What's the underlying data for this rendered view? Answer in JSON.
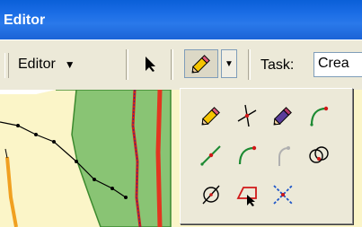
{
  "window": {
    "title": "Editor"
  },
  "toolbar": {
    "editor_menu_label": "Editor",
    "task_label": "Task:",
    "task_value": "Crea"
  },
  "palette": {
    "tools": [
      {
        "icon": "sketch-pencil-icon"
      },
      {
        "icon": "intersection-icon"
      },
      {
        "icon": "sketch-pencil-purple-icon"
      },
      {
        "icon": "arc-icon"
      },
      {
        "icon": "midpoint-icon"
      },
      {
        "icon": "endpoint-arc-icon"
      },
      {
        "icon": "tangent-curve-icon"
      },
      {
        "icon": "circle-icon"
      },
      {
        "icon": "distance-distance-icon"
      },
      {
        "icon": "trace-icon"
      },
      {
        "icon": "right-angle-icon"
      },
      {
        "icon": "empty"
      }
    ]
  }
}
